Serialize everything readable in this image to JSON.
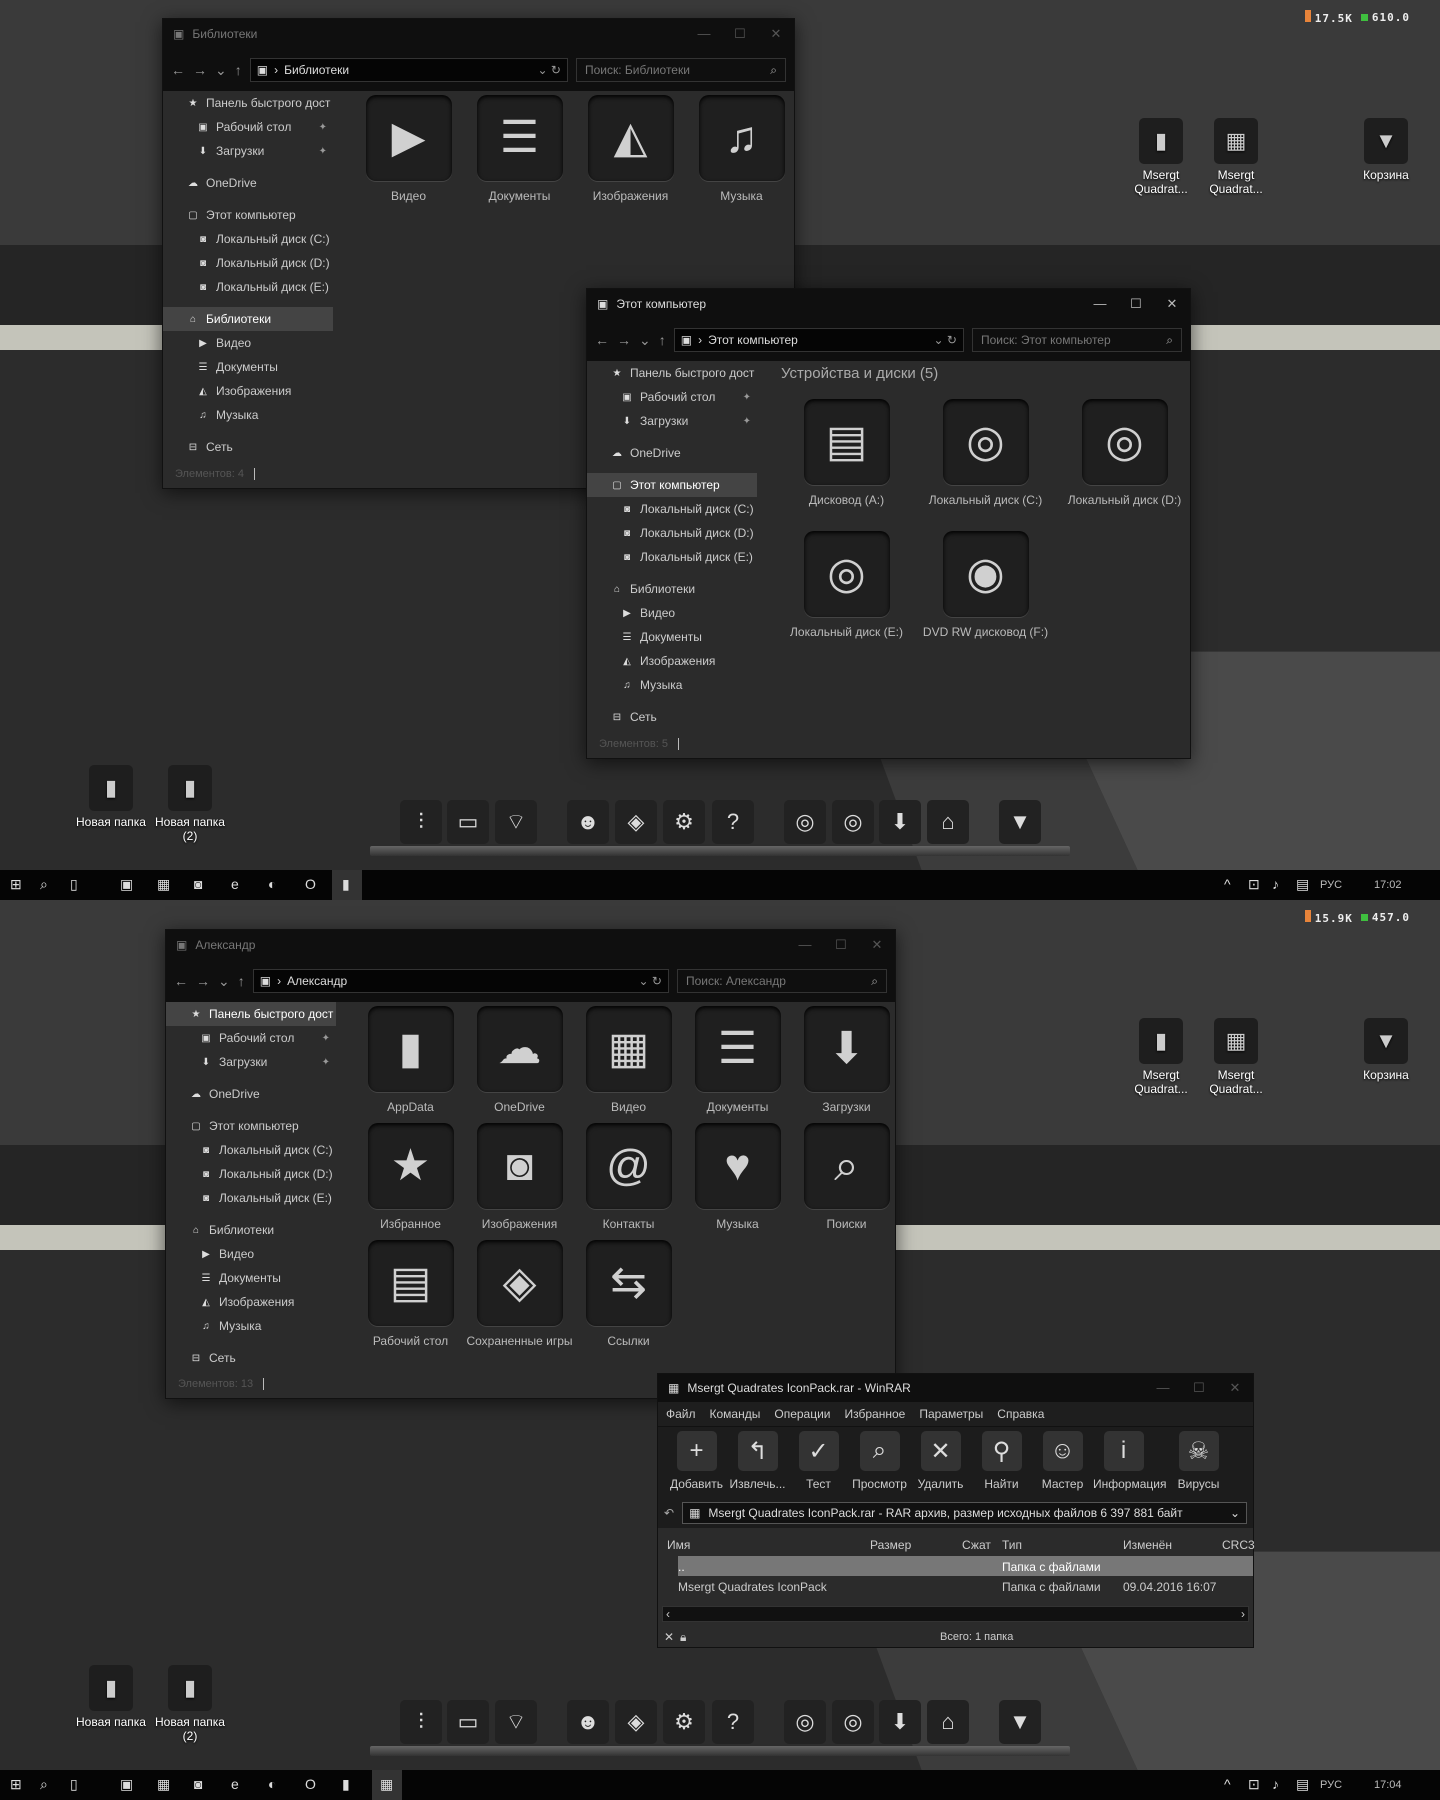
{
  "top": {
    "stats": {
      "net": "17.5K",
      "cpu": "610.0"
    },
    "desktop_icons": [
      {
        "label": "Msergt Quadrat...",
        "icon": "folder-icon"
      },
      {
        "label": "Msergt Quadrat...",
        "icon": "rar-icon"
      },
      {
        "label": "Корзина",
        "icon": "recycle-bin-icon"
      },
      {
        "label": "Новая папка",
        "icon": "folder-icon"
      },
      {
        "label": "Новая папка (2)",
        "icon": "folder-icon"
      }
    ],
    "win_libraries": {
      "title": "Библиотеки",
      "address": "Библиотеки",
      "search": "Поиск: Библиотеки",
      "nav": [
        {
          "label": "Панель быстрого дост",
          "icon": "★",
          "level": 0
        },
        {
          "label": "Рабочий стол",
          "icon": "▣",
          "level": 1,
          "pin": true
        },
        {
          "label": "Загрузки",
          "icon": "⬇",
          "level": 1,
          "pin": true
        },
        {
          "label": "OneDrive",
          "icon": "☁",
          "level": 0,
          "gap": true
        },
        {
          "label": "Этот компьютер",
          "icon": "▢",
          "level": 0,
          "gap": true
        },
        {
          "label": "Локальный диск (C:)",
          "icon": "◙",
          "level": 1
        },
        {
          "label": "Локальный диск (D:)",
          "icon": "◙",
          "level": 1
        },
        {
          "label": "Локальный диск (E:)",
          "icon": "◙",
          "level": 1
        },
        {
          "label": "Библиотеки",
          "icon": "⌂",
          "level": 0,
          "gap": true,
          "selected": true
        },
        {
          "label": "Видео",
          "icon": "▶",
          "level": 1
        },
        {
          "label": "Документы",
          "icon": "☰",
          "level": 1
        },
        {
          "label": "Изображения",
          "icon": "◭",
          "level": 1
        },
        {
          "label": "Музыка",
          "icon": "♫",
          "level": 1
        },
        {
          "label": "Сеть",
          "icon": "⊟",
          "level": 0,
          "gap": true
        }
      ],
      "items": [
        {
          "label": "Видео",
          "icon": "▶"
        },
        {
          "label": "Документы",
          "icon": "☰"
        },
        {
          "label": "Изображения",
          "icon": "◭"
        },
        {
          "label": "Музыка",
          "icon": "♫"
        }
      ],
      "status": "Элементов: 4"
    },
    "win_thispc": {
      "title": "Этот компьютер",
      "address": "Этот компьютер",
      "search": "Поиск: Этот компьютер",
      "section": "Устройства и диски (5)",
      "nav": [
        {
          "label": "Панель быстрого дост",
          "icon": "★",
          "level": 0
        },
        {
          "label": "Рабочий стол",
          "icon": "▣",
          "level": 1,
          "pin": true
        },
        {
          "label": "Загрузки",
          "icon": "⬇",
          "level": 1,
          "pin": true
        },
        {
          "label": "OneDrive",
          "icon": "☁",
          "level": 0,
          "gap": true
        },
        {
          "label": "Этот компьютер",
          "icon": "▢",
          "level": 0,
          "gap": true,
          "selected": true
        },
        {
          "label": "Локальный диск (C:)",
          "icon": "◙",
          "level": 1
        },
        {
          "label": "Локальный диск (D:)",
          "icon": "◙",
          "level": 1
        },
        {
          "label": "Локальный диск (E:)",
          "icon": "◙",
          "level": 1
        },
        {
          "label": "Библиотеки",
          "icon": "⌂",
          "level": 0,
          "gap": true
        },
        {
          "label": "Видео",
          "icon": "▶",
          "level": 1
        },
        {
          "label": "Документы",
          "icon": "☰",
          "level": 1
        },
        {
          "label": "Изображения",
          "icon": "◭",
          "level": 1
        },
        {
          "label": "Музыка",
          "icon": "♫",
          "level": 1
        },
        {
          "label": "Сеть",
          "icon": "⊟",
          "level": 0,
          "gap": true
        }
      ],
      "items": [
        {
          "label": "Дисковод (A:)",
          "icon": "▤"
        },
        {
          "label": "Локальный диск (C:)",
          "icon": "◎"
        },
        {
          "label": "Локальный диск (D:)",
          "icon": "◎"
        },
        {
          "label": "Локальный диск (E:)",
          "icon": "◎"
        },
        {
          "label": "DVD RW дисковод (F:)",
          "icon": "◉"
        }
      ],
      "status": "Элементов: 5"
    },
    "clock": "17:02"
  },
  "bottom": {
    "stats": {
      "net": "15.9K",
      "cpu": "457.0"
    },
    "win_user": {
      "title": "Александр",
      "address": "Александр",
      "search": "Поиск: Александр",
      "nav": [
        {
          "label": "Панель быстрого дост",
          "icon": "★",
          "level": 0,
          "selected": true
        },
        {
          "label": "Рабочий стол",
          "icon": "▣",
          "level": 1,
          "pin": true
        },
        {
          "label": "Загрузки",
          "icon": "⬇",
          "level": 1,
          "pin": true
        },
        {
          "label": "OneDrive",
          "icon": "☁",
          "level": 0,
          "gap": true
        },
        {
          "label": "Этот компьютер",
          "icon": "▢",
          "level": 0,
          "gap": true
        },
        {
          "label": "Локальный диск (C:)",
          "icon": "◙",
          "level": 1
        },
        {
          "label": "Локальный диск (D:)",
          "icon": "◙",
          "level": 1
        },
        {
          "label": "Локальный диск (E:)",
          "icon": "◙",
          "level": 1
        },
        {
          "label": "Библиотеки",
          "icon": "⌂",
          "level": 0,
          "gap": true
        },
        {
          "label": "Видео",
          "icon": "▶",
          "level": 1
        },
        {
          "label": "Документы",
          "icon": "☰",
          "level": 1
        },
        {
          "label": "Изображения",
          "icon": "◭",
          "level": 1
        },
        {
          "label": "Музыка",
          "icon": "♫",
          "level": 1
        },
        {
          "label": "Сеть",
          "icon": "⊟",
          "level": 0,
          "gap": true
        }
      ],
      "items": [
        {
          "label": "AppData",
          "icon": "▮"
        },
        {
          "label": "OneDrive",
          "icon": "☁"
        },
        {
          "label": "Видео",
          "icon": "▦"
        },
        {
          "label": "Документы",
          "icon": "☰"
        },
        {
          "label": "Загрузки",
          "icon": "⬇"
        },
        {
          "label": "Избранное",
          "icon": "★"
        },
        {
          "label": "Изображения",
          "icon": "◙"
        },
        {
          "label": "Контакты",
          "icon": "@"
        },
        {
          "label": "Музыка",
          "icon": "♥"
        },
        {
          "label": "Поиски",
          "icon": "⌕"
        },
        {
          "label": "Рабочий стол",
          "icon": "▤"
        },
        {
          "label": "Сохраненные игры",
          "icon": "◈"
        },
        {
          "label": "Ссылки",
          "icon": "⇆"
        }
      ],
      "status": "Элементов: 13"
    },
    "winrar": {
      "title": "Msergt Quadrates IconPack.rar - WinRAR",
      "menu": [
        "Файл",
        "Команды",
        "Операции",
        "Избранное",
        "Параметры",
        "Справка"
      ],
      "tools": [
        {
          "label": "Добавить",
          "icon": "+"
        },
        {
          "label": "Извлечь...",
          "icon": "↰"
        },
        {
          "label": "Тест",
          "icon": "✓"
        },
        {
          "label": "Просмотр",
          "icon": "⌕"
        },
        {
          "label": "Удалить",
          "icon": "✕"
        },
        {
          "label": "Найти",
          "icon": "⚲"
        },
        {
          "label": "Мастер",
          "icon": "☺"
        },
        {
          "label": "Информация",
          "icon": "i"
        },
        {
          "label": "Вирусы",
          "icon": "☠"
        }
      ],
      "path": "Msergt Quadrates IconPack.rar - RAR архив, размер исходных файлов 6 397 881 байт",
      "columns": [
        "Имя",
        "Размер",
        "Сжат",
        "Тип",
        "Изменён",
        "CRC3"
      ],
      "rows": [
        {
          "name": "..",
          "type": "Папка с файлами",
          "modified": ""
        },
        {
          "name": "Msergt Quadrates IconPack",
          "type": "Папка с файлами",
          "modified": "09.04.2016 16:07"
        }
      ],
      "status": "Всего: 1 папка"
    },
    "clock": "17:04"
  },
  "taskbar": {
    "lang": "РУС"
  }
}
